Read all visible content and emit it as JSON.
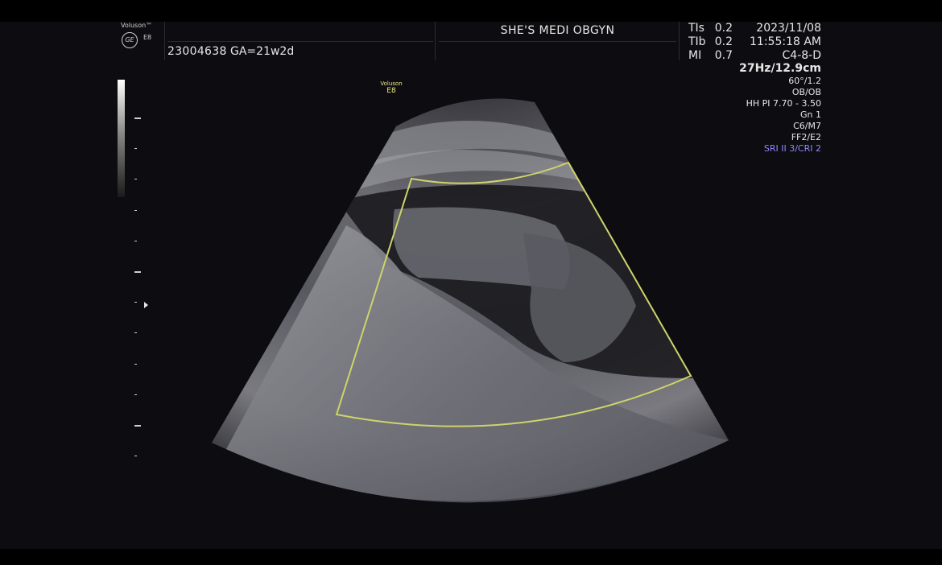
{
  "header": {
    "brand_name": "Voluson™",
    "brand_model": "E8",
    "ge_logo_text": "GE",
    "patient_id": "23004638",
    "gestational_age": "GA=21w2d",
    "clinic_name": "SHE'S MEDI OBGYN"
  },
  "safety": {
    "tis_label": "TIs",
    "tis_value": "0.2",
    "tib_label": "TIb",
    "tib_value": "0.2",
    "mi_label": "MI",
    "mi_value": "0.7"
  },
  "status": {
    "date": "2023/11/08",
    "time": "11:55:18 AM",
    "probe": "C4-8-D",
    "frame_rate_depth": "27Hz/12.9cm",
    "angle": "60°/1.2",
    "preset": "OB/OB",
    "harmonic": "HH PI 7.70 - 3.50",
    "gain": "Gn   1",
    "c_m": "C6/M7",
    "ff_e": "FF2/E2",
    "sri_cri": "SRI II 3/CRI 2"
  },
  "image_overlay": {
    "vol_label": "Voluson",
    "vol_model": "E8"
  },
  "colors": {
    "roi_box": "#cfd36a",
    "sri_text": "#8f87ff",
    "background": "#0d0d11"
  }
}
